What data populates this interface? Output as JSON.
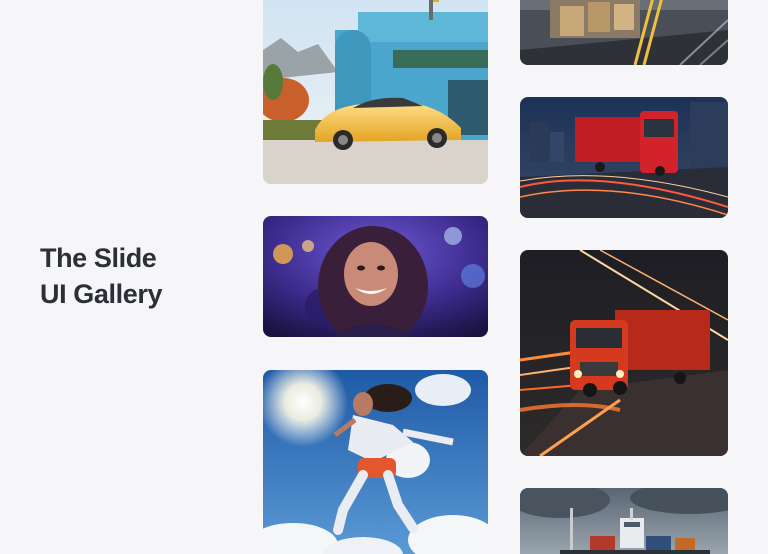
{
  "title": {
    "line1": "The Slide",
    "line2": "UI Gallery"
  },
  "gallery": {
    "images": [
      {
        "name": "sports-car-image",
        "subject": "yellow sports car in front of blue building"
      },
      {
        "name": "smiling-woman-image",
        "subject": "smiling woman at a concert with colorful lights"
      },
      {
        "name": "jumping-woman-image",
        "subject": "woman jumping against blue sky with clouds"
      },
      {
        "name": "warehouse-road-image",
        "subject": "road with warehouse boxes"
      },
      {
        "name": "red-truck-image",
        "subject": "red truck speeding through city at dusk"
      },
      {
        "name": "orange-truck-image",
        "subject": "orange truck in tunnel with light trails"
      },
      {
        "name": "cargo-ship-image",
        "subject": "cargo ship under cloudy sky"
      }
    ]
  },
  "colors": {
    "background": "#f6f6f8",
    "heading": "#2b2f36"
  }
}
